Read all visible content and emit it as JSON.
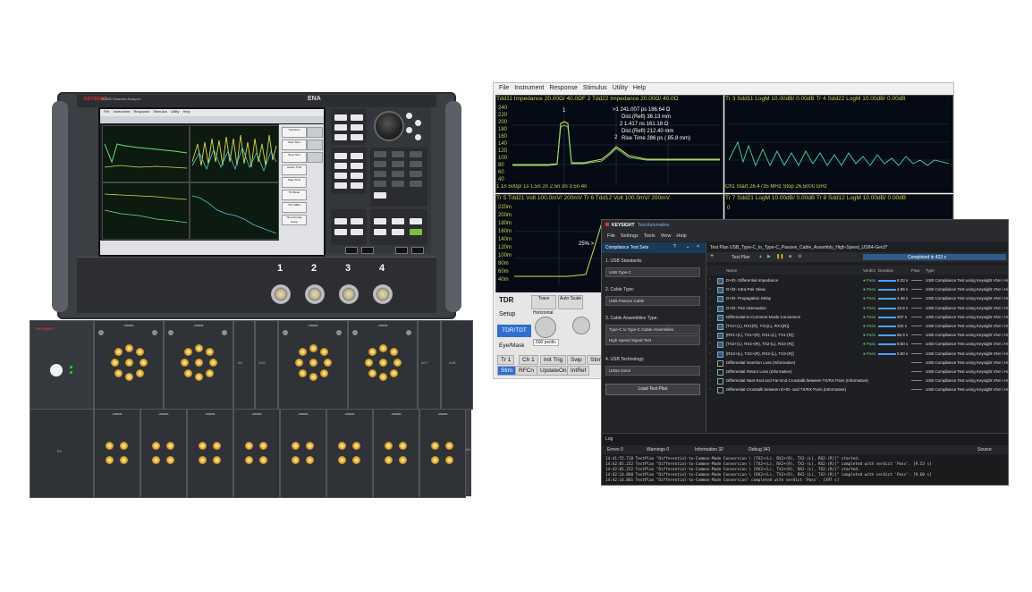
{
  "vna": {
    "brand": "KEYSIGHT",
    "model": "E5080 Network Analyzer",
    "ena": "ENA",
    "menu": [
      "File",
      "Instrument",
      "Response",
      "Stimulus",
      "Utility",
      "Help"
    ],
    "softkeys": [
      "Transform",
      "Start Time",
      "Stop Time",
      "Center Time",
      "Span Time",
      "TD Mode",
      "TD TraBar",
      "Time Domain Setup"
    ],
    "ports": [
      "1",
      "2",
      "3",
      "4"
    ],
    "keygroups": [
      "Instrument",
      "Response",
      "Entry",
      "Stimulus",
      "Utility"
    ]
  },
  "tdr": {
    "menu": [
      "File",
      "Instrument",
      "Response",
      "Stimulus",
      "Utility",
      "Help"
    ],
    "pane1": {
      "header": "Tdd11 Impedance 20.00Ω/ 40.0ΩF  2  Tdd22 Impedance 20.00Ω/ 40.0Ω",
      "markers": [
        ">1   241.007 ps    186.64 Ω",
        "Dist.(Refl)   36.13 mm",
        "2   1.417 ns    161.18 Ω",
        "Dist.(Refl)   212.40 mm",
        "Rise Time   286 ps   ( 85.8 mm)"
      ],
      "yticks": [
        "240",
        "220",
        "200",
        "180",
        "160",
        "140",
        "120",
        "100",
        "80",
        "60",
        "40"
      ],
      "footer": "1    1n    500p/    1s    1.5n    2n    2.5n    3n    3.5n    4n"
    },
    "pane2": {
      "header": "Tr 3  Sdd11 LogM 10.00dB/ 0.00dB   Tr 4  Sdd22 LogM 10.00dB/ 0.00dB",
      "footer": "Ch1  Start  26.4735 MHz                              Stop  26.5000 GHz"
    },
    "pane3": {
      "header": "Tr 5  Tdd21 Volt 100.0mV/ 200mV   Tr 6  Tdd12 Volt 100.0mV/ 200mV",
      "yticks": [
        "220m",
        "200m",
        "180m",
        "160m",
        "140m",
        "120m",
        "100m",
        "80m",
        "60m",
        "40m",
        "20m"
      ],
      "marker": "25% >"
    },
    "pane4": {
      "header": "Tr 7  Sdd21 LogM 10.00dB/ 0.00dB   Tr 8  Sdd12 LogM 10.00dB/ 0.00dB"
    },
    "controls": {
      "tdr_label": "TDR",
      "setup": "Setup",
      "tdr_tdt": "TDR/TDT",
      "eye_mask": "Eye/Mask",
      "trace": "Trace",
      "auto_scale": "Auto Scale",
      "horizontal": "Horizontal",
      "value": "500 ps/div",
      "tabs": [
        "Tr 1",
        "Ch 1",
        "Init Trig",
        "Swp",
        "Stim"
      ],
      "tabs2": [
        "Stim",
        "RFCn",
        "UpdateOn",
        "IntRef"
      ]
    }
  },
  "ta": {
    "brand": "KEYSIGHT",
    "title": "Test Automation",
    "menu": [
      "File",
      "Settings",
      "Tools",
      "View",
      "Help"
    ],
    "left_head": "Compliance Test Sets",
    "fields": [
      {
        "label": "1. USB Standards:",
        "value": "USB Type-C"
      },
      {
        "label": "2. Cable Type:",
        "value": "USB Passive Cable"
      },
      {
        "label": "3. Cable Assemblies Type:",
        "value": "Type-C to Type-C Cable Assemblies"
      },
      {
        "label": "",
        "value": "High-Speed Signal Test"
      },
      {
        "label": "4. USB Technology:",
        "value": "USB4 Gen3"
      }
    ],
    "load_btn": "Load Test Plan",
    "plan_title": "Test Plan  USB_Type-C_to_Type-C_Passive_Cable_Assembly_High-Speed_USB4-Gen3*",
    "test_plan_label": "Test Plan",
    "completed": "Completed in 423 s",
    "columns": {
      "name": "Name",
      "verdict": "Verdict",
      "duration": "Duration",
      "flow": "Flow",
      "type": "Type"
    },
    "rows": [
      {
        "name": "D+/D- Differential Impedance",
        "verdict": "● Pass",
        "duration": "6.33 s",
        "type": "USB Compliance Test using Keysight VNA \\ Hig",
        "on": true
      },
      {
        "name": "D+/D- Intra-Pair Skew",
        "verdict": "● Pass",
        "duration": "4.89 s",
        "type": "USB Compliance Test using Keysight VNA \\ Hig",
        "on": true
      },
      {
        "name": "D+/D- Propagation Delay",
        "verdict": "● Pass",
        "duration": "4.48 s",
        "type": "USB Compliance Test using Keysight VNA \\ Hig",
        "on": true
      },
      {
        "name": "D+/D- Pair Attenuation",
        "verdict": "● Pass",
        "duration": "10.9 s",
        "type": "USB Compliance Test using Keysight VNA \\ Hig",
        "on": true
      },
      {
        "name": "Differential-to-Common-Mode Conversion",
        "verdict": "● Pass",
        "duration": "207 s",
        "type": "USB Compliance Test using Keysight VNA \\ Hig",
        "on": true
      },
      {
        "name": "[TX1+(L), RX1(R), TX1(L), RX1(R)]",
        "verdict": "● Pass",
        "duration": "322 s",
        "type": "USB Compliance Test using Keysight VNA \\ Hig",
        "on": true
      },
      {
        "name": "[RX1+(L), TX1+(R), RX1-(L), TX1-(R)]",
        "verdict": "● Pass",
        "duration": "55.3 s",
        "type": "USB Compliance Test using Keysight VNA \\ Hig",
        "on": true
      },
      {
        "name": "[TX2+(L), RX2+(R), TX2-(L), RX2-(R)]",
        "verdict": "● Pass",
        "duration": "9.60 s",
        "type": "USB Compliance Test using Keysight VNA \\ Hig",
        "on": true
      },
      {
        "name": "[RX2+(L), TX2+(R), RX2-(L), TX2-(R)]",
        "verdict": "● Pass",
        "duration": "9.60 s",
        "type": "USB Compliance Test using Keysight VNA \\ Hig",
        "on": true
      },
      {
        "name": "Differential Insertion Loss (Informative)",
        "verdict": "",
        "duration": "",
        "type": "USB Compliance Test using Keysight VNA \\ Hig",
        "on": false
      },
      {
        "name": "Differential Return Loss (Informative)",
        "verdict": "",
        "duration": "",
        "type": "USB Compliance Test using Keysight VNA \\ Hig",
        "on": false
      },
      {
        "name": "Differential Near-End and Far-End Crosstalk between TX/RX Pairs (Informative)",
        "verdict": "",
        "duration": "",
        "type": "USB Compliance Test using Keysight VNA \\ Hig",
        "on": false
      },
      {
        "name": "Differential Crosstalk between D+/D- and TX/RX Pairs (Informative)",
        "verdict": "",
        "duration": "",
        "type": "USB Compliance Test using Keysight VNA \\ Hig",
        "on": false
      }
    ],
    "log_title": "Log",
    "log_filters": {
      "errors": "Errors 0",
      "warnings": "Warnings 0",
      "information": "Information 32",
      "debug": "Debug 341",
      "source": "Source"
    },
    "log_lines": [
      "14:41:55.718  TestPlan  \"Differential-to-Common-Mode Conversion \\ [TX2+(L), RX2+(R), TX2-(L), RX2-(R)]\" started.",
      "14:42:05.252  TestPlan  \"Differential-to-Common-Mode Conversion \\ [TX2+(L), RX2+(R), TX2-(L), RX2-(R)]\" completed with verdict 'Pass'. [9.53 s]",
      "14:42:05.252  TestPlan  \"Differential-to-Common-Mode Conversion \\ [RX2+(L), TX2+(R), RX2-(L), TX2-(R)]\" started.",
      "14:42:14.860  TestPlan  \"Differential-to-Common-Mode Conversion \\ [RX2+(L), TX2+(R), RX2-(L), TX2-(R)]\" completed with verdict 'Pass'. [9.60 s]",
      "14:42:14.861  TestPlan  \"Differential-to-Common-Mode Conversion\" completed with verdict 'Pass'. [397 s]"
    ]
  },
  "matrix": {
    "brand": "KEYSIGHT",
    "module": "L8990M",
    "slot_labels": [
      "A3",
      "A2G",
      "ACT",
      "A1B",
      "B3",
      "B18"
    ]
  }
}
